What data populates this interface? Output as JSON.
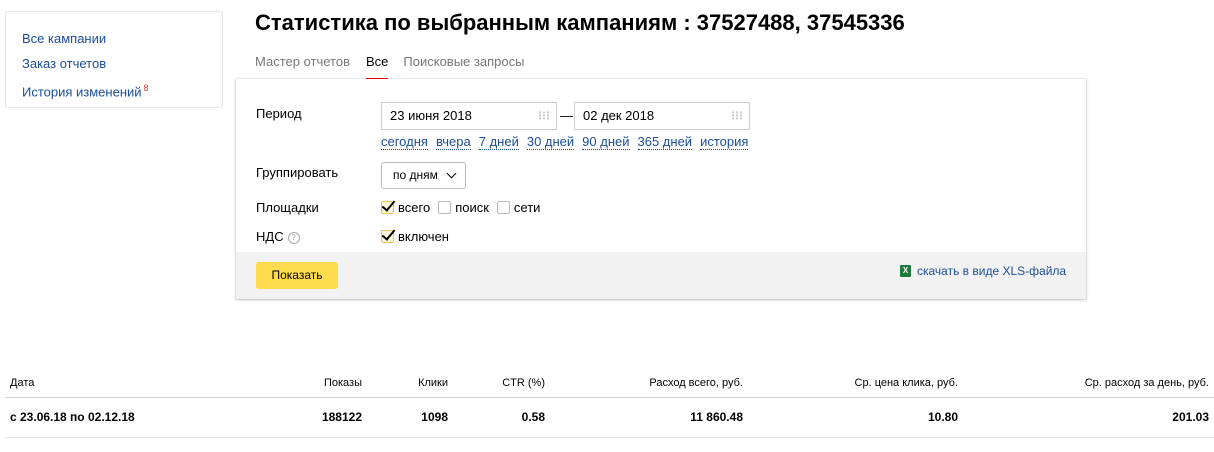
{
  "sidebar": {
    "items": [
      {
        "label": "Все кампании"
      },
      {
        "label": "Заказ отчетов"
      },
      {
        "label": "История изменений",
        "badge": "8"
      }
    ]
  },
  "page": {
    "title": "Статистика по выбранным кампаниям : 37527488, 37545336"
  },
  "tabs": [
    {
      "label": "Мастер отчетов",
      "active": false
    },
    {
      "label": "Все",
      "active": true
    },
    {
      "label": "Поисковые запросы",
      "active": false
    }
  ],
  "form": {
    "period_label": "Период",
    "date_from": "23 июня 2018",
    "date_separator": "—",
    "date_to": "02 дек 2018",
    "quick_periods": [
      "сегодня",
      "вчера",
      "7 дней",
      "30 дней",
      "90 дней",
      "365 дней",
      "история"
    ],
    "group_label": "Группировать",
    "group_value": "по дням",
    "platforms_label": "Площадки",
    "platforms": [
      {
        "label": "всего",
        "checked": true
      },
      {
        "label": "поиск",
        "checked": false
      },
      {
        "label": "сети",
        "checked": false
      }
    ],
    "vat_label": "НДС",
    "vat_help": "?",
    "vat_option": {
      "label": "включен",
      "checked": true
    },
    "show_button": "Показать",
    "xls_link": "скачать в виде XLS-файла",
    "xls_icon": "X"
  },
  "stats": {
    "headers": [
      "Дата",
      "Показы",
      "Клики",
      "CTR (%)",
      "Расход всего, руб.",
      "Ср. цена клика, руб.",
      "Ср. расход за день, руб."
    ],
    "rows": [
      [
        "с 23.06.18 по 02.12.18",
        "188122",
        "1098",
        "0.58",
        "11 860.48",
        "10.80",
        "201.03"
      ]
    ]
  },
  "colors": {
    "link": "#1a4d99",
    "button_yellow": "#ffdb4d",
    "active_tab_underline": "#ff0000",
    "badge": "#e53935"
  }
}
